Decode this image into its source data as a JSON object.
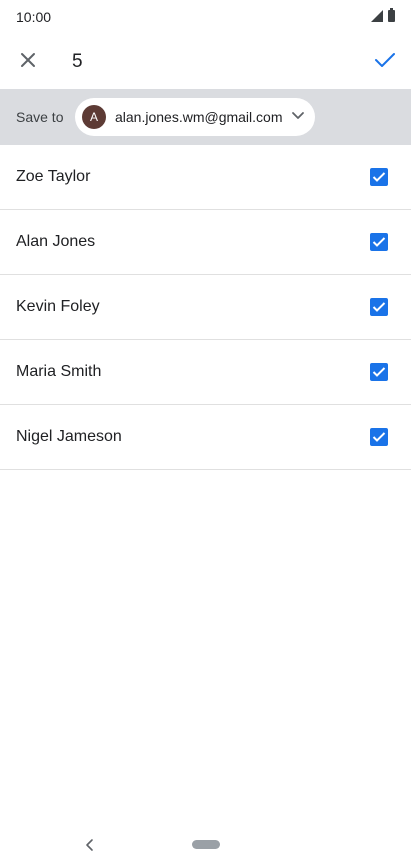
{
  "status_bar": {
    "time": "10:00"
  },
  "top_bar": {
    "selected_count": "5"
  },
  "save_bar": {
    "label": "Save to",
    "account_initial": "A",
    "account_email": "alan.jones.wm@gmail.com"
  },
  "contacts": [
    {
      "name": "Zoe Taylor",
      "checked": true
    },
    {
      "name": "Alan Jones",
      "checked": true
    },
    {
      "name": "Kevin Foley",
      "checked": true
    },
    {
      "name": "Maria Smith",
      "checked": true
    },
    {
      "name": "Nigel Jameson",
      "checked": true
    }
  ],
  "colors": {
    "accent": "#1a73e8",
    "save_bar_bg": "#dadce0",
    "avatar_bg": "#5d3b35"
  }
}
